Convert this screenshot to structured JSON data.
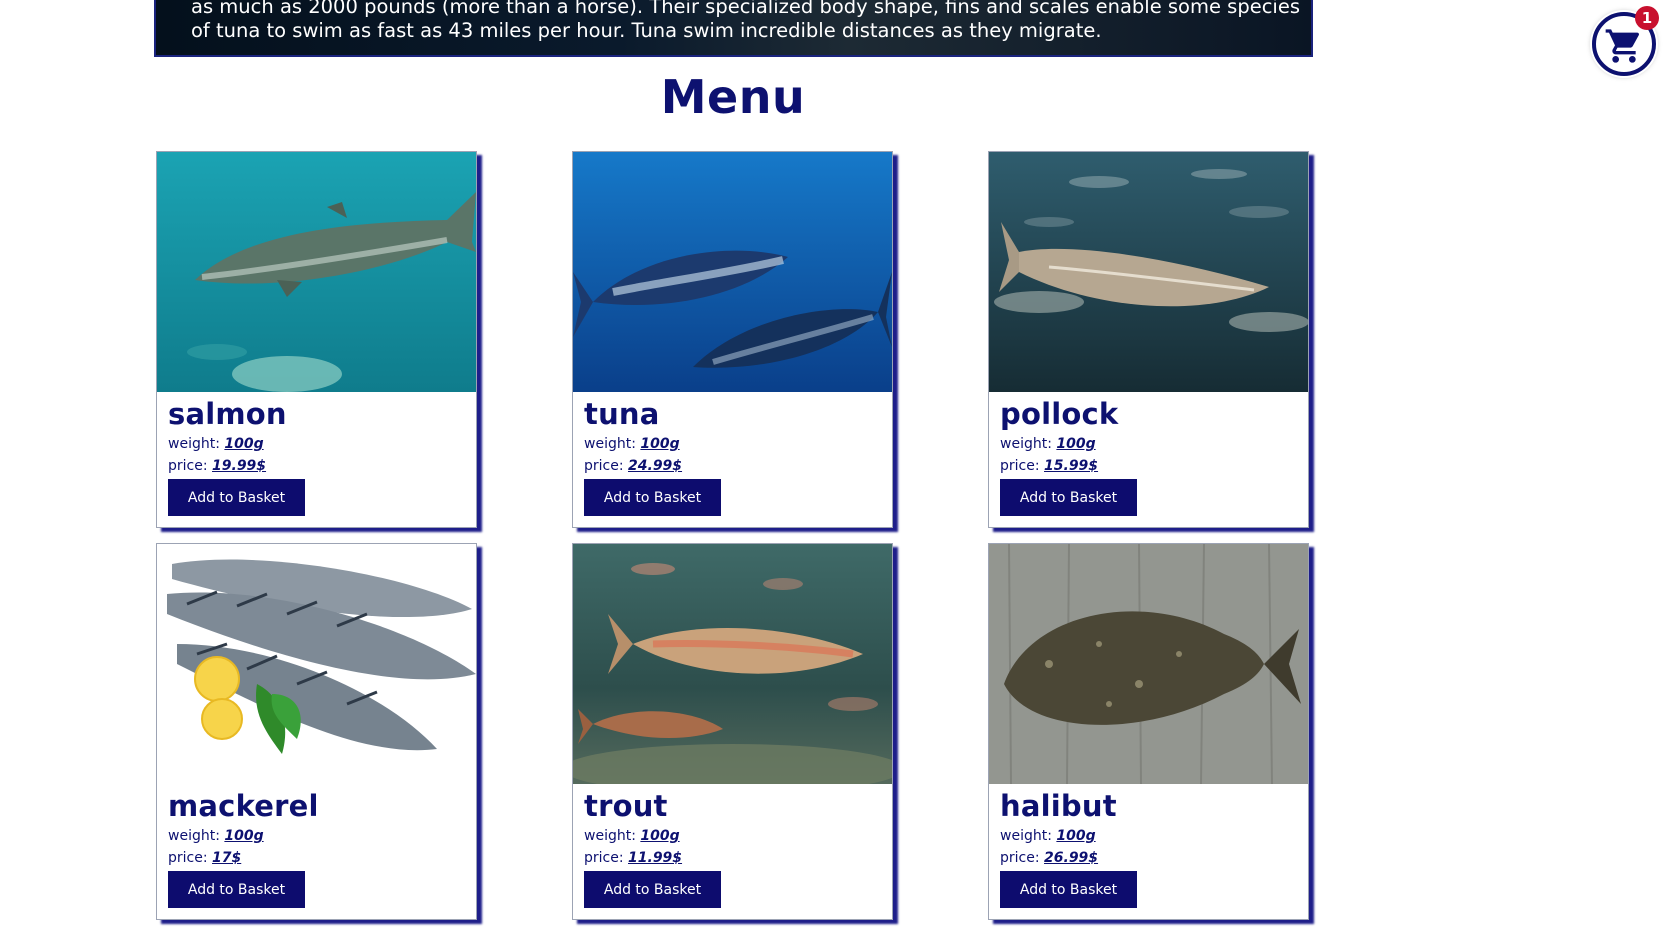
{
  "banner": {
    "text": "as much as 2000 pounds (more than a horse). Their specialized body shape, fins and scales enable some species of tuna to swim as fast as 43 miles per hour. Tuna swim incredible distances as they migrate."
  },
  "menu": {
    "title": "Menu"
  },
  "cart": {
    "count": "1",
    "icon": "cart-icon"
  },
  "labels": {
    "weight": "weight: ",
    "price": "price: ",
    "add_button": "Add to Basket"
  },
  "products": [
    {
      "name": "salmon",
      "weight": "100g",
      "price": "19.99$",
      "image": "salmon-photo"
    },
    {
      "name": "tuna",
      "weight": "100g",
      "price": "24.99$",
      "image": "tuna-photo"
    },
    {
      "name": "pollock",
      "weight": "100g",
      "price": "15.99$",
      "image": "pollock-photo"
    },
    {
      "name": "mackerel",
      "weight": "100g",
      "price": "17$",
      "image": "mackerel-photo"
    },
    {
      "name": "trout",
      "weight": "100g",
      "price": "11.99$",
      "image": "trout-photo"
    },
    {
      "name": "halibut",
      "weight": "100g",
      "price": "26.99$",
      "image": "halibut-photo"
    }
  ],
  "colors": {
    "brand": "#0d1170",
    "button": "#0d0c6e",
    "badge": "#c8102e"
  }
}
